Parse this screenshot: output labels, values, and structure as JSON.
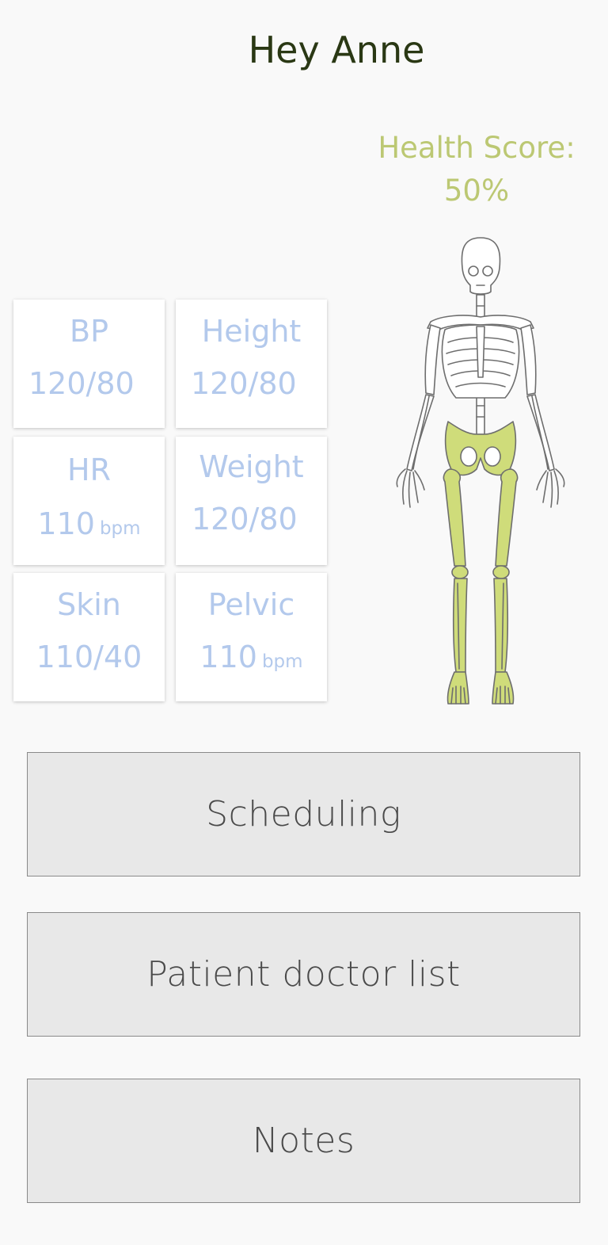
{
  "header": {
    "greeting": "Hey Anne"
  },
  "health_score": {
    "label": "Health Score:",
    "value": "50%"
  },
  "metrics": [
    {
      "label": "BP",
      "value": "120/80",
      "unit": ""
    },
    {
      "label": "Height",
      "value": "120/80",
      "unit": ""
    },
    {
      "label": "HR",
      "value": "110",
      "unit": "bpm"
    },
    {
      "label": "Weight",
      "value": "120/80",
      "unit": ""
    },
    {
      "label": "Skin",
      "value": "110/40",
      "unit": ""
    },
    {
      "label": "Pelvic",
      "value": "110",
      "unit": "bpm"
    }
  ],
  "skeleton": {
    "bone_color": "#ffffff",
    "highlight_color": "#cfdc7a",
    "highlighted": [
      "pelvis",
      "legs",
      "feet"
    ]
  },
  "actions": {
    "scheduling": "Scheduling",
    "doctor_list": "Patient doctor list",
    "notes": "Notes"
  },
  "colors": {
    "greeting": "#2a3814",
    "score": "#bcc873",
    "metric_text": "#b3c9ec",
    "button_bg": "#e8e8e8"
  }
}
